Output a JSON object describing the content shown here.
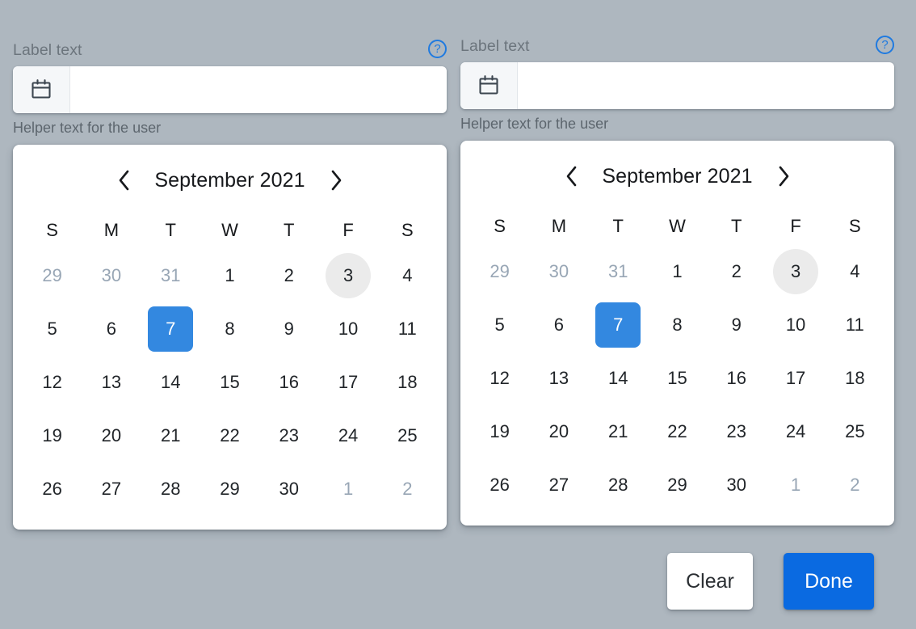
{
  "theme": {
    "background": "#aeb7bf",
    "accent": "#1f7ae0",
    "selected_day_color": "#3388e0",
    "done_button_color": "#0a6ae1",
    "today_circle_color": "#ebebeb",
    "muted_day_color": "#98a6b5"
  },
  "pickers": [
    {
      "label": "Label text",
      "help_icon": "help-circle-icon",
      "calendar_icon": "calendar-icon",
      "input_value": "",
      "input_placeholder": "",
      "helper_text": "Helper text for the user",
      "calendar": {
        "prev_icon": "chevron-left-icon",
        "next_icon": "chevron-right-icon",
        "month_title": "September 2021",
        "weekdays": [
          "S",
          "M",
          "T",
          "W",
          "T",
          "F",
          "S"
        ],
        "weeks": [
          [
            {
              "day": "29",
              "state": "muted"
            },
            {
              "day": "30",
              "state": "muted"
            },
            {
              "day": "31",
              "state": "muted"
            },
            {
              "day": "1",
              "state": "normal"
            },
            {
              "day": "2",
              "state": "normal"
            },
            {
              "day": "3",
              "state": "today"
            },
            {
              "day": "4",
              "state": "normal"
            }
          ],
          [
            {
              "day": "5",
              "state": "normal"
            },
            {
              "day": "6",
              "state": "normal"
            },
            {
              "day": "7",
              "state": "selected"
            },
            {
              "day": "8",
              "state": "normal"
            },
            {
              "day": "9",
              "state": "normal"
            },
            {
              "day": "10",
              "state": "normal"
            },
            {
              "day": "11",
              "state": "normal"
            }
          ],
          [
            {
              "day": "12",
              "state": "normal"
            },
            {
              "day": "13",
              "state": "normal"
            },
            {
              "day": "14",
              "state": "normal"
            },
            {
              "day": "15",
              "state": "normal"
            },
            {
              "day": "16",
              "state": "normal"
            },
            {
              "day": "17",
              "state": "normal"
            },
            {
              "day": "18",
              "state": "normal"
            }
          ],
          [
            {
              "day": "19",
              "state": "normal"
            },
            {
              "day": "20",
              "state": "normal"
            },
            {
              "day": "21",
              "state": "normal"
            },
            {
              "day": "22",
              "state": "normal"
            },
            {
              "day": "23",
              "state": "normal"
            },
            {
              "day": "24",
              "state": "normal"
            },
            {
              "day": "25",
              "state": "normal"
            }
          ],
          [
            {
              "day": "26",
              "state": "normal"
            },
            {
              "day": "27",
              "state": "normal"
            },
            {
              "day": "28",
              "state": "normal"
            },
            {
              "day": "29",
              "state": "normal"
            },
            {
              "day": "30",
              "state": "normal"
            },
            {
              "day": "1",
              "state": "muted"
            },
            {
              "day": "2",
              "state": "muted"
            }
          ]
        ]
      }
    },
    {
      "label": "Label text",
      "help_icon": "help-circle-icon",
      "calendar_icon": "calendar-icon",
      "input_value": "",
      "input_placeholder": "",
      "helper_text": "Helper text for the user",
      "calendar": {
        "prev_icon": "chevron-left-icon",
        "next_icon": "chevron-right-icon",
        "month_title": "September 2021",
        "weekdays": [
          "S",
          "M",
          "T",
          "W",
          "T",
          "F",
          "S"
        ],
        "weeks": [
          [
            {
              "day": "29",
              "state": "muted"
            },
            {
              "day": "30",
              "state": "muted"
            },
            {
              "day": "31",
              "state": "muted"
            },
            {
              "day": "1",
              "state": "normal"
            },
            {
              "day": "2",
              "state": "normal"
            },
            {
              "day": "3",
              "state": "today"
            },
            {
              "day": "4",
              "state": "normal"
            }
          ],
          [
            {
              "day": "5",
              "state": "normal"
            },
            {
              "day": "6",
              "state": "normal"
            },
            {
              "day": "7",
              "state": "selected"
            },
            {
              "day": "8",
              "state": "normal"
            },
            {
              "day": "9",
              "state": "normal"
            },
            {
              "day": "10",
              "state": "normal"
            },
            {
              "day": "11",
              "state": "normal"
            }
          ],
          [
            {
              "day": "12",
              "state": "normal"
            },
            {
              "day": "13",
              "state": "normal"
            },
            {
              "day": "14",
              "state": "normal"
            },
            {
              "day": "15",
              "state": "normal"
            },
            {
              "day": "16",
              "state": "normal"
            },
            {
              "day": "17",
              "state": "normal"
            },
            {
              "day": "18",
              "state": "normal"
            }
          ],
          [
            {
              "day": "19",
              "state": "normal"
            },
            {
              "day": "20",
              "state": "normal"
            },
            {
              "day": "21",
              "state": "normal"
            },
            {
              "day": "22",
              "state": "normal"
            },
            {
              "day": "23",
              "state": "normal"
            },
            {
              "day": "24",
              "state": "normal"
            },
            {
              "day": "25",
              "state": "normal"
            }
          ],
          [
            {
              "day": "26",
              "state": "normal"
            },
            {
              "day": "27",
              "state": "normal"
            },
            {
              "day": "28",
              "state": "normal"
            },
            {
              "day": "29",
              "state": "normal"
            },
            {
              "day": "30",
              "state": "normal"
            },
            {
              "day": "1",
              "state": "muted"
            },
            {
              "day": "2",
              "state": "muted"
            }
          ]
        ]
      }
    }
  ],
  "actions": {
    "clear_label": "Clear",
    "done_label": "Done"
  },
  "help_glyph": "?"
}
